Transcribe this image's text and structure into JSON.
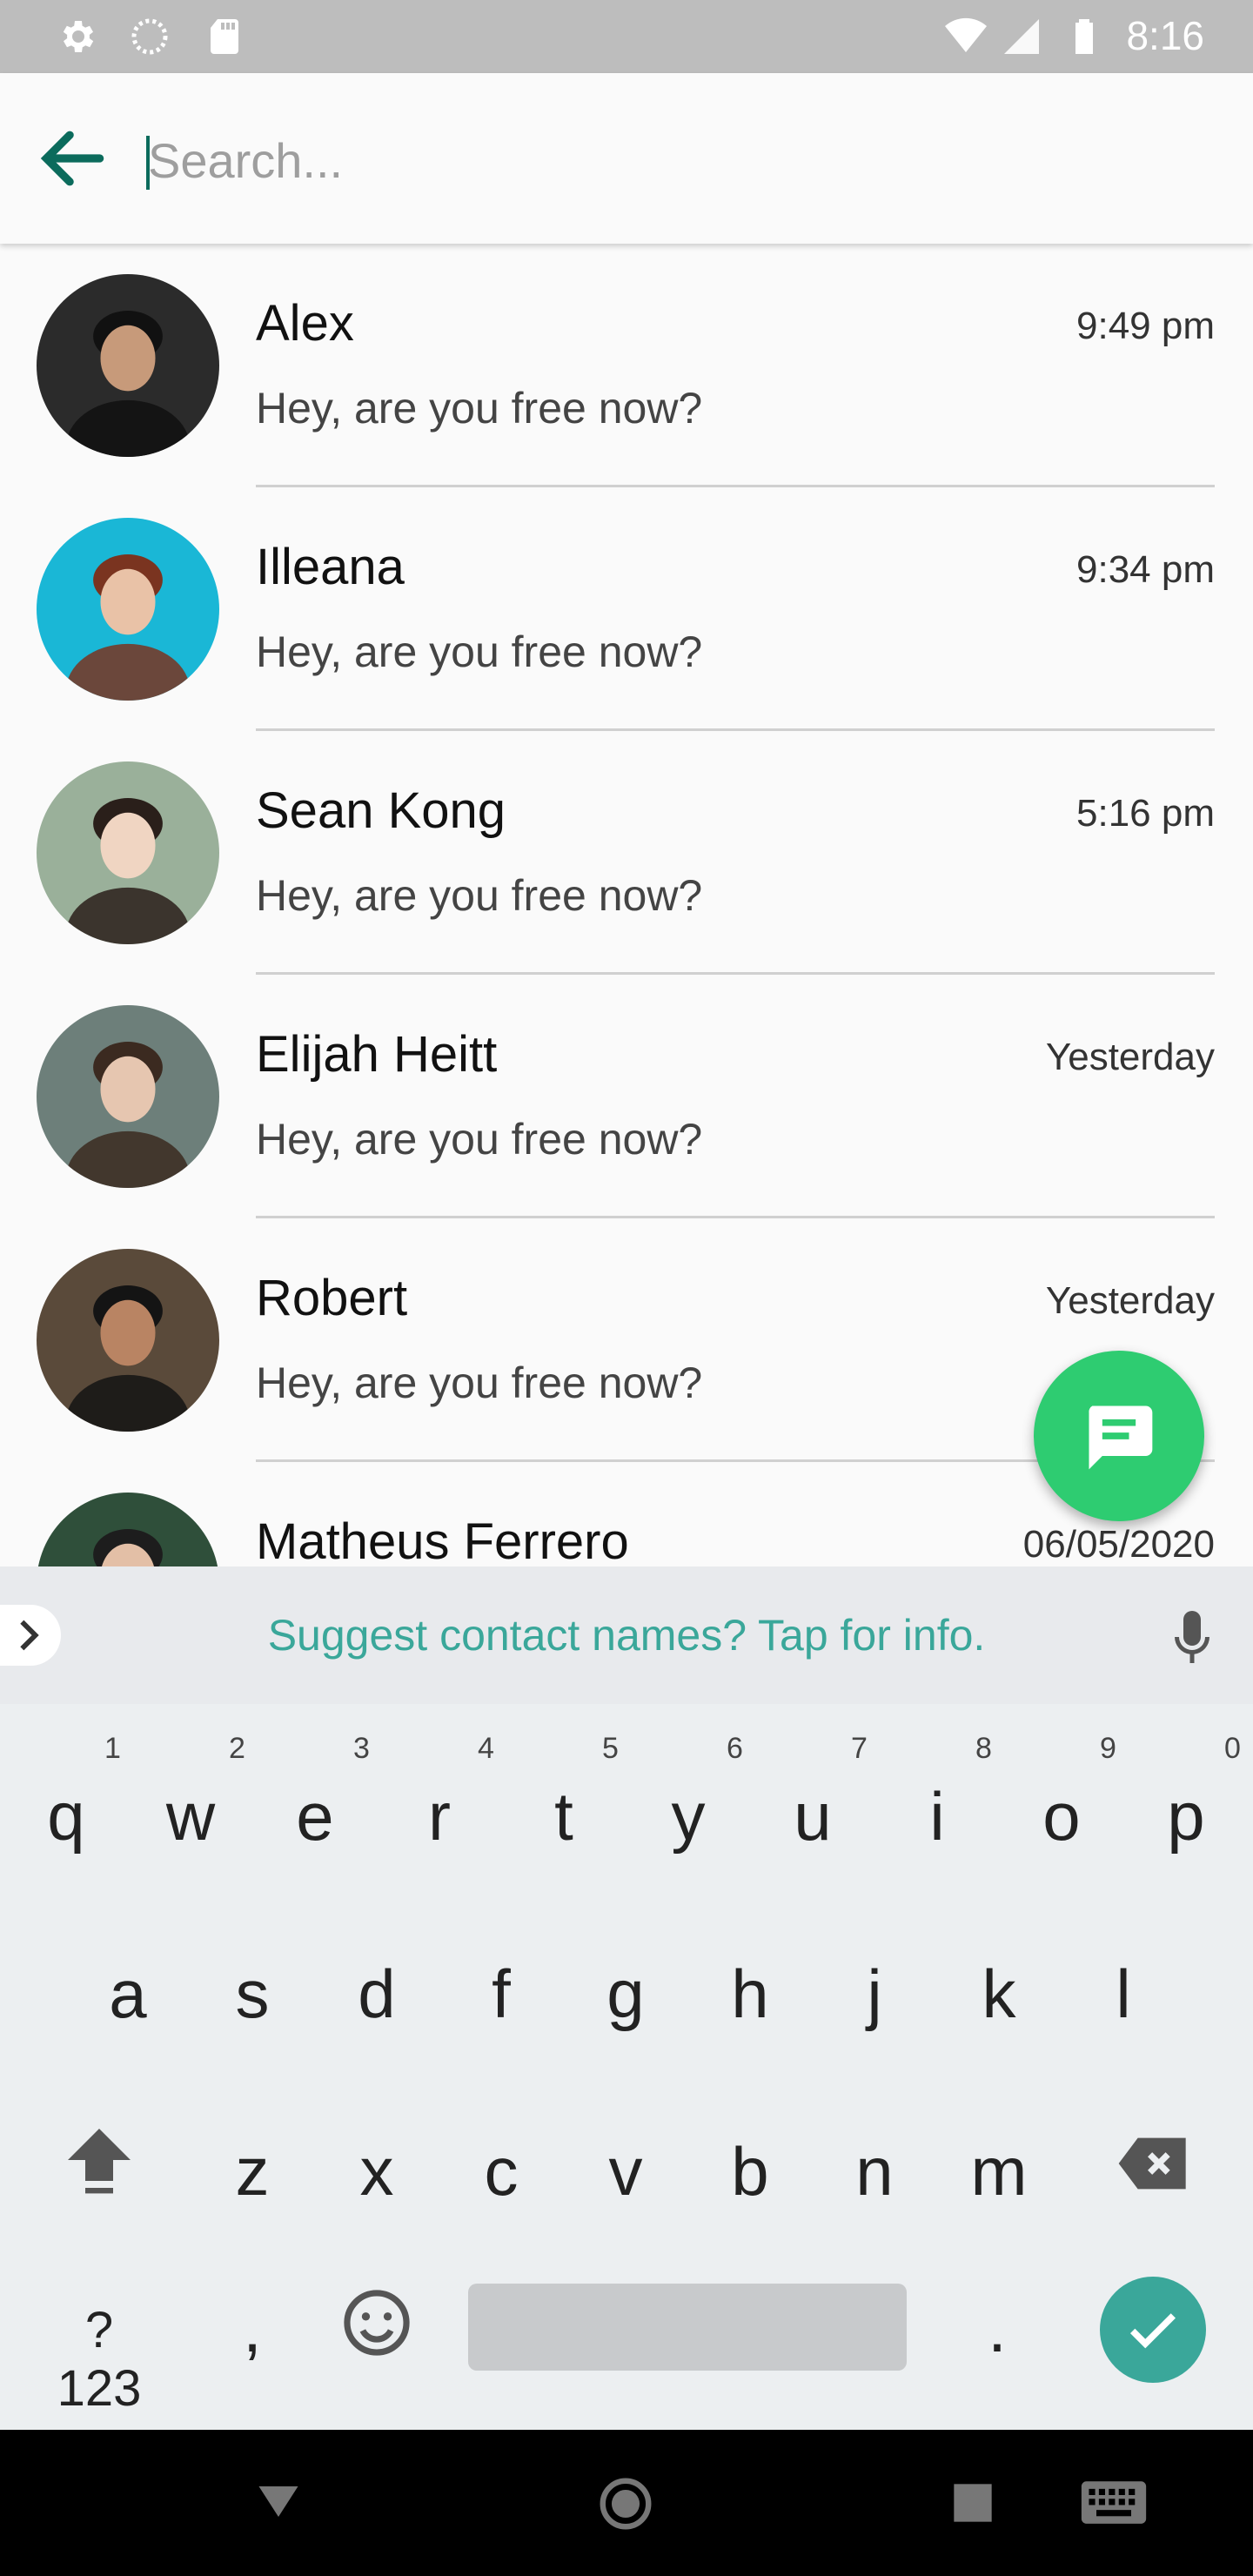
{
  "status_bar": {
    "time": "8:16",
    "icons": [
      "settings-icon",
      "sync-icon",
      "sd-card-icon",
      "wifi-icon",
      "signal-icon",
      "battery-icon"
    ]
  },
  "search": {
    "placeholder": "Search...",
    "value": ""
  },
  "chats": [
    {
      "name": "Alex",
      "message": "Hey, are you free now?",
      "time": "9:49 pm",
      "avatar": {
        "bg": "#2b2b2b",
        "skin": "#c79a7a",
        "hair": "#111"
      }
    },
    {
      "name": "Illeana",
      "message": "Hey, are you free now?",
      "time": "9:34 pm",
      "avatar": {
        "bg": "#1ab7d6",
        "skin": "#e9c2a7",
        "hair": "#7a3420"
      }
    },
    {
      "name": "Sean Kong",
      "message": "Hey, are you free now?",
      "time": "5:16 pm",
      "avatar": {
        "bg": "#9ab09a",
        "skin": "#f0d5c2",
        "hair": "#2a1f1a"
      }
    },
    {
      "name": "Elijah Heitt",
      "message": "Hey, are you free now?",
      "time": "Yesterday",
      "avatar": {
        "bg": "#6d7f7a",
        "skin": "#e6c6b0",
        "hair": "#3b2a20"
      }
    },
    {
      "name": "Robert",
      "message": "Hey, are you free now?",
      "time": "Yesterday",
      "avatar": {
        "bg": "#5a4a3a",
        "skin": "#b98463",
        "hair": "#141414"
      }
    },
    {
      "name": "Matheus Ferrero",
      "message": "Hey, are you free now?",
      "time": "06/05/2020",
      "avatar": {
        "bg": "#2f4f3a",
        "skin": "#e3bfa6",
        "hair": "#1d1d1d"
      }
    }
  ],
  "suggestion": {
    "text": "Suggest contact names? Tap for info."
  },
  "keyboard": {
    "row1": [
      "q",
      "w",
      "e",
      "r",
      "t",
      "y",
      "u",
      "i",
      "o",
      "p"
    ],
    "row1_hints": [
      "1",
      "2",
      "3",
      "4",
      "5",
      "6",
      "7",
      "8",
      "9",
      "0"
    ],
    "row2": [
      "a",
      "s",
      "d",
      "f",
      "g",
      "h",
      "j",
      "k",
      "l"
    ],
    "row3": [
      "z",
      "x",
      "c",
      "v",
      "b",
      "n",
      "m"
    ],
    "symbols_label": "?123",
    "comma": ",",
    "period": "."
  },
  "colors": {
    "accent": "#3aa79a",
    "fab": "#2ecc71",
    "back_arrow": "#0b6b5c"
  }
}
